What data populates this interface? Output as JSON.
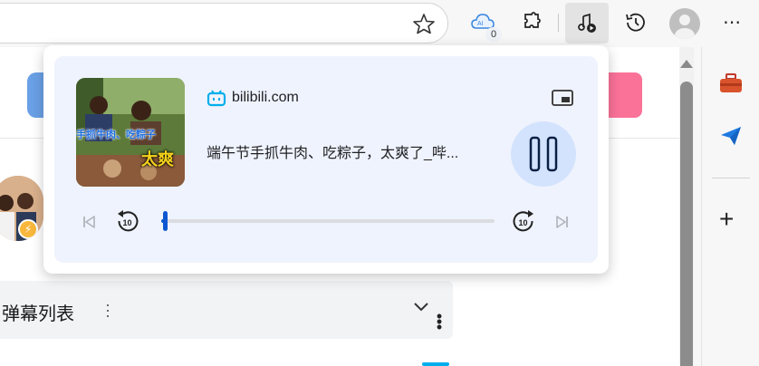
{
  "toolbar": {
    "favorite_icon": "star-outline-icon",
    "ai_extension_badge": "0",
    "extensions_icon": "puzzle-icon",
    "media_control_icon": "music-note-play-icon",
    "history_icon": "history-clock-icon",
    "profile_icon": "avatar-icon",
    "more_label": "⋯"
  },
  "media_popup": {
    "site_icon": "bilibili-tv-icon",
    "site_name": "bilibili.com",
    "track_title": "端午节手抓牛肉、吃粽子，太爽了_哔...",
    "thumbnail_caption": "手抓牛肉、吃粽子",
    "thumbnail_tag": "太爽",
    "pip_icon": "picture-in-picture-icon",
    "play_state": "playing",
    "pause_icon": "pause-icon",
    "previous_icon": "skip-previous-icon",
    "rewind_label": "10",
    "forward_label": "10",
    "next_icon": "skip-next-icon",
    "progress": 0.01,
    "accent_color": "#0b57d0",
    "play_button_bg": "#d3e3fd"
  },
  "page": {
    "danmaku_list_label": "弹幕列表",
    "danmaku_menu_icon": "vertical-dots-icon",
    "danmaku_expand_icon": "chevron-down-icon",
    "overflow_icon": "vertical-dots-icon",
    "brand_pink": "#fb7299"
  },
  "side_panel": {
    "tools_icon": "toolbox-icon",
    "send_icon": "paper-plane-icon",
    "add_label": "+"
  }
}
